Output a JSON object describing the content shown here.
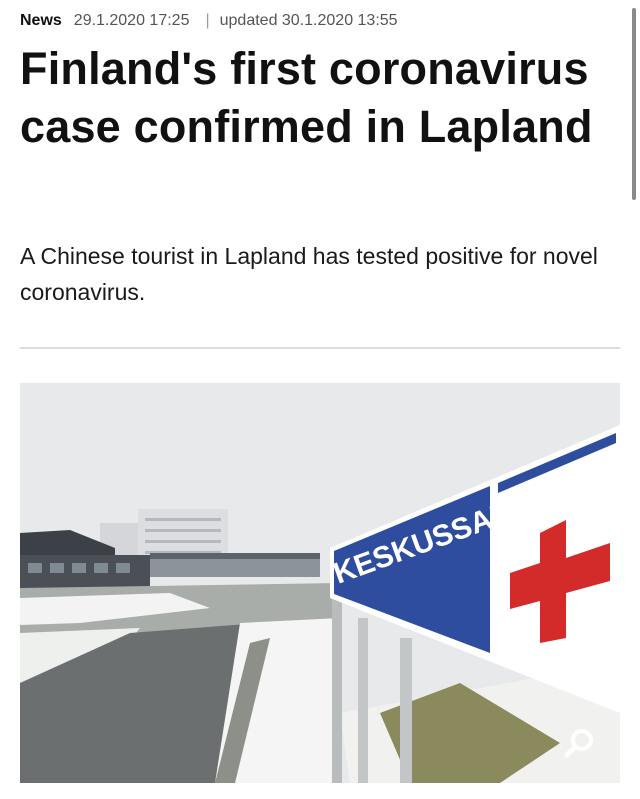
{
  "article": {
    "category": "News",
    "published": "29.1.2020 17:25",
    "separator": "|",
    "updated": "updated 30.1.2020 13:55",
    "headline": "Finland's first coronavirus case confirmed in Lapland",
    "lead": "A Chinese tourist in Lapland has tested positive for novel coronavirus."
  },
  "photo": {
    "sign_text": "KESKUSSAIRAALA",
    "zoom_icon": "magnifier-icon",
    "colors": {
      "sign_blue": "#2f4d9e",
      "cross_red": "#d32a2a",
      "sky": "#e8e9eb"
    }
  }
}
